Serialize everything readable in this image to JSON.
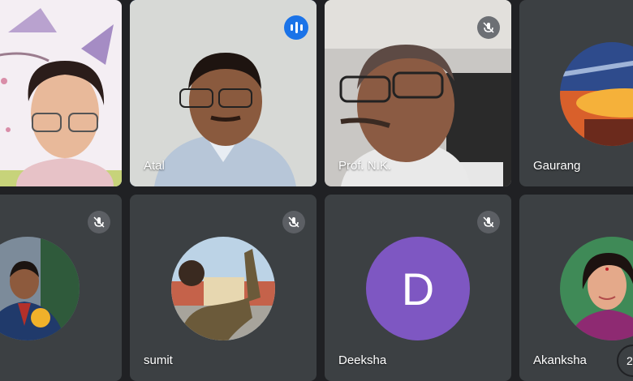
{
  "participants": [
    {
      "name": ""
    },
    {
      "name": "Atal"
    },
    {
      "name": "Prof. N.K."
    },
    {
      "name": "Gaurang"
    },
    {
      "name": ""
    },
    {
      "name": "sumit"
    },
    {
      "name": "Deeksha",
      "initial": "D"
    },
    {
      "name": "Akanksha"
    }
  ],
  "overflow_count": "2",
  "colors": {
    "tile": "#3c4043",
    "background": "#202124",
    "speaking": "#1a73e8",
    "deeksha_avatar": "#7e57c2"
  }
}
